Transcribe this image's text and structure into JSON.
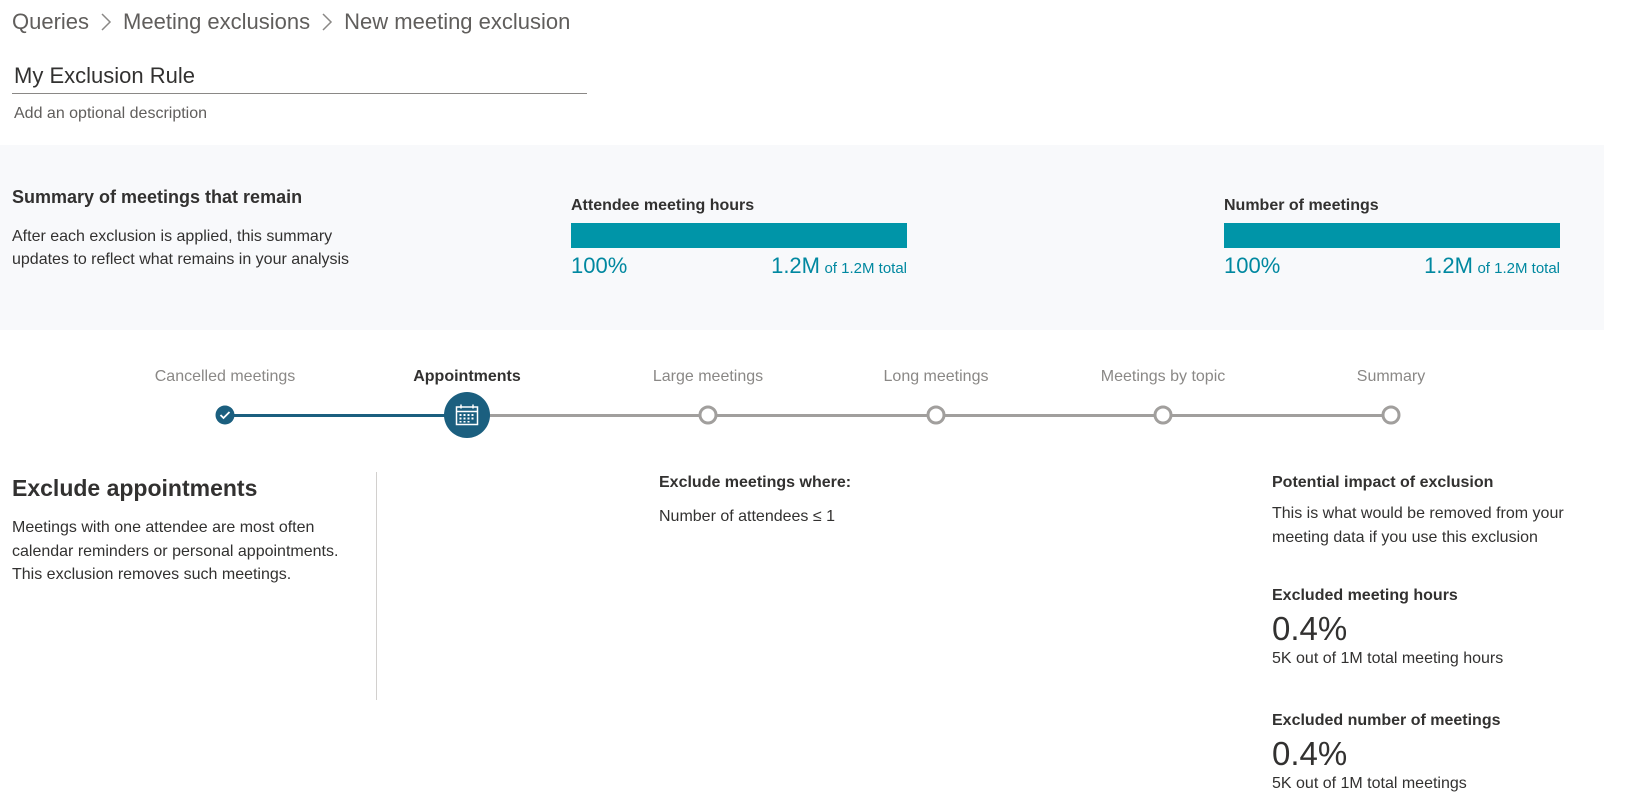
{
  "breadcrumb": {
    "items": [
      "Queries",
      "Meeting exclusions",
      "New meeting exclusion"
    ]
  },
  "rule": {
    "name": "My Exclusion Rule",
    "description_placeholder": "Add an optional description"
  },
  "summary": {
    "title": "Summary of meetings that remain",
    "text": "After each exclusion is applied, this summary updates to reflect what remains in your analysis",
    "metrics": [
      {
        "title": "Attendee meeting hours",
        "fraction": 1.0,
        "percent_label": "100%",
        "value": "1.2M",
        "total_label": "of 1.2M total"
      },
      {
        "title": "Number of meetings",
        "fraction": 1.0,
        "percent_label": "100%",
        "value": "1.2M",
        "total_label": "of 1.2M total"
      }
    ]
  },
  "stepper": {
    "current_index": 1,
    "steps": [
      {
        "label": "Cancelled meetings",
        "state": "done",
        "icon": "check-icon"
      },
      {
        "label": "Appointments",
        "state": "current",
        "icon": "calendar-icon"
      },
      {
        "label": "Large meetings",
        "state": "todo"
      },
      {
        "label": "Long meetings",
        "state": "todo"
      },
      {
        "label": "Meetings by topic",
        "state": "todo"
      },
      {
        "label": "Summary",
        "state": "todo"
      }
    ]
  },
  "exclusion": {
    "title": "Exclude appointments",
    "description": "Meetings with one attendee are most often calendar reminders or personal appointments. This exclusion removes such meetings."
  },
  "condition": {
    "title": "Exclude meetings where:",
    "value": "Number of attendees ≤ 1"
  },
  "impact": {
    "title": "Potential impact of exclusion",
    "text": "This is what would be removed from your meeting data if you use this exclusion",
    "hours": {
      "title": "Excluded meeting hours",
      "value": "0.4%",
      "sub": "5K out of 1M total meeting hours"
    },
    "meetings": {
      "title": "Excluded number of meetings",
      "value": "0.4%",
      "sub": "5K out of 1M total meetings"
    }
  },
  "colors": {
    "accent_teal": "#0095a8",
    "stepper_dark": "#1b5f7f",
    "stepper_todo": "#a19f9d",
    "summary_bg": "#f8f9fb"
  }
}
